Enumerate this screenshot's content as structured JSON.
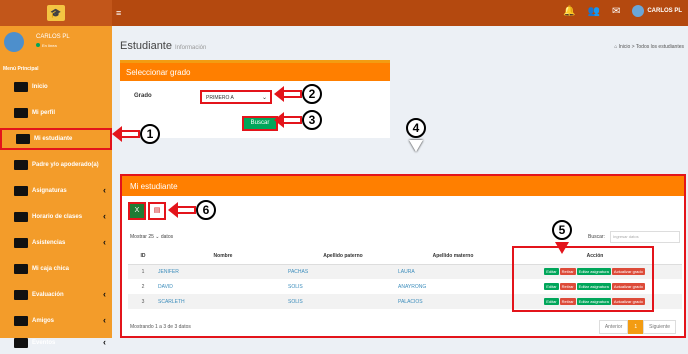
{
  "topbar": {
    "user_name": "CARLOS PL",
    "menu_icon": "hamburger-icon",
    "badge1": "",
    "badge2": ""
  },
  "sidebar": {
    "user_name": "CARLOS PL",
    "user_status": "En línea",
    "menu_header": "Menú Principal",
    "items": [
      {
        "label": "Inicio",
        "icon": "home-icon"
      },
      {
        "label": "Mi perfil",
        "icon": "user-icon"
      },
      {
        "label": "Mi estudiante",
        "icon": "graduation-cap-icon"
      },
      {
        "label": "Padre y/o apoderado(a)",
        "icon": "family-icon"
      },
      {
        "label": "Asignaturas",
        "icon": "book-icon"
      },
      {
        "label": "Horario de clases",
        "icon": "calendar-icon"
      },
      {
        "label": "Asistencias",
        "icon": "check-calendar-icon"
      },
      {
        "label": "Mi caja chica",
        "icon": "money-icon"
      },
      {
        "label": "Evaluación",
        "icon": "evaluation-icon"
      },
      {
        "label": "Amigos",
        "icon": "friends-icon"
      },
      {
        "label": "Eventos",
        "icon": "events-icon"
      }
    ]
  },
  "header": {
    "title": "Estudiante",
    "subtitle": "Información",
    "breadcrumb_home": "Inicio",
    "breadcrumb_current": "Todos los estudiantes"
  },
  "grade_box": {
    "title": "Seleccionar grado",
    "grado_label": "Grado",
    "selected": "PRIMERO A",
    "search_button": "Buscar"
  },
  "students_box": {
    "title": "Mi estudiante",
    "show_prefix": "Mostrar",
    "show_value": "25",
    "show_suffix": "datos",
    "search_label": "Buscar:",
    "search_placeholder": "Ingresar datos",
    "columns": [
      "ID",
      "Nombre",
      "Apellido paterno",
      "Apellido materno",
      "Acción"
    ],
    "rows": [
      {
        "id": "1",
        "nombre": "JENIFER",
        "paterno": "PACHAS",
        "materno": "LAURA"
      },
      {
        "id": "2",
        "nombre": "DAVID",
        "paterno": "SOLIS",
        "materno": "ANAYRONG"
      },
      {
        "id": "3",
        "nombre": "SCARLETH",
        "paterno": "SOLIS",
        "materno": "PALACIOS"
      }
    ],
    "actions": [
      "Editar",
      "Retirar",
      "Editar asignatura",
      "Actualizar grado"
    ],
    "showing": "Mostrando 1 a 3 de 3 datos",
    "prev": "Anterior",
    "page": "1",
    "next": "Siguiente"
  },
  "callouts": [
    "1",
    "2",
    "3",
    "4",
    "5",
    "6"
  ]
}
